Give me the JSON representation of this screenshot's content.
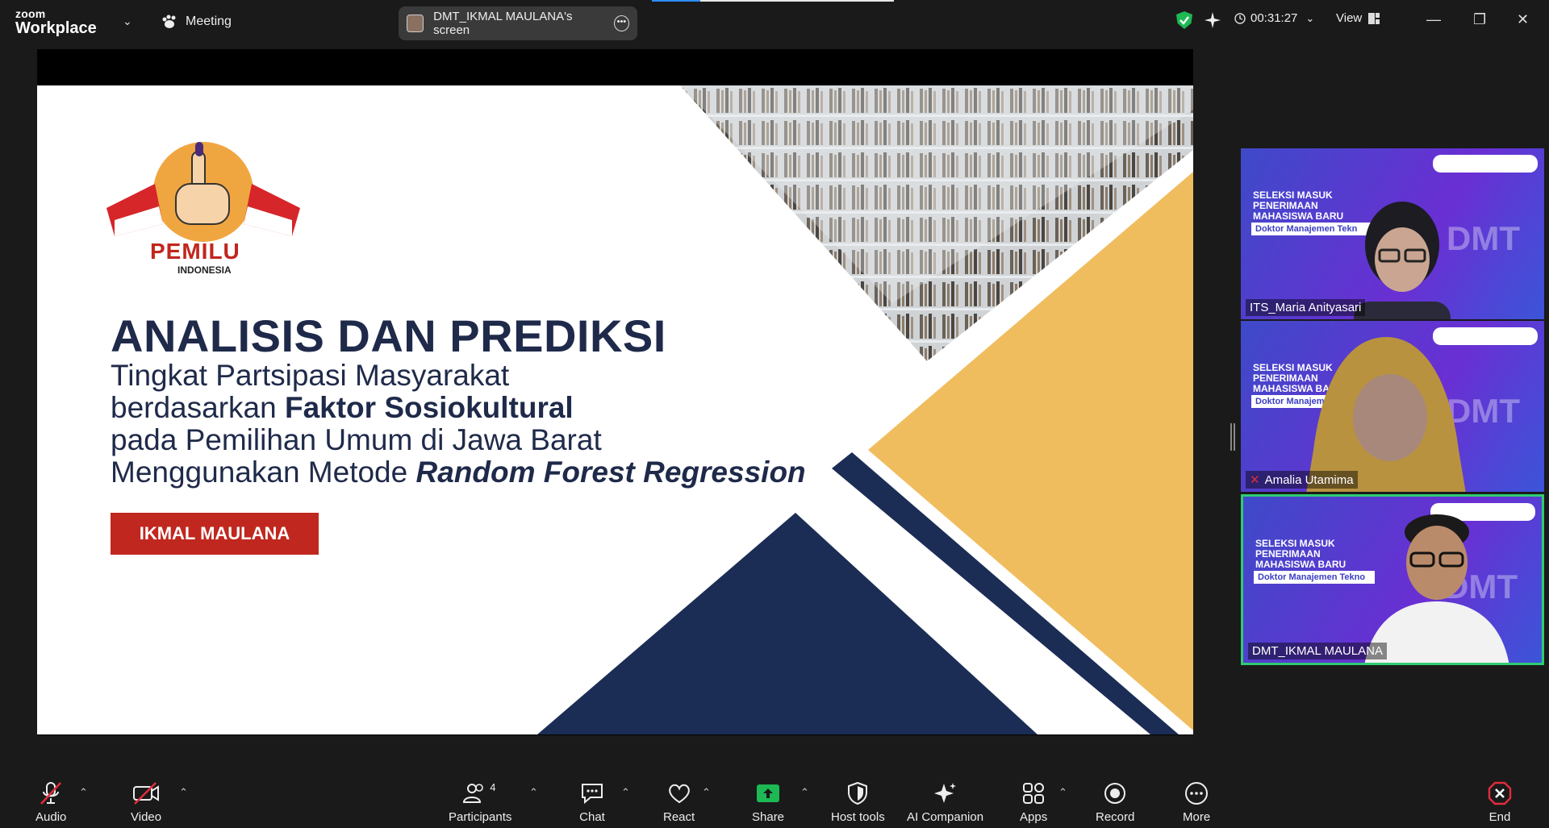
{
  "topbar": {
    "logo_small": "zoom",
    "logo_big": "Workplace",
    "meeting_label": "Meeting",
    "share_label": "DMT_IKMAL MAULANA's screen",
    "timer": "00:31:27",
    "view_label": "View"
  },
  "slide": {
    "logo_title": "PEMILU",
    "logo_sub": "INDONESIA",
    "title": "ANALISIS DAN PREDIKSI",
    "line1": "Tingkat Partsipasi Masyarakat",
    "line2_prefix": "berdasarkan ",
    "line2_bold": "Faktor Sosiokultural",
    "line3": "pada Pemilihan Umum di Jawa Barat",
    "line4_prefix": "Menggunakan Metode ",
    "line4_bold": "Random Forest Regression",
    "presenter": "IKMAL MAULANA"
  },
  "gallery": [
    {
      "name": "ITS_Maria Anityasari",
      "t1": "SELEKSI MASUK PENERIMAAN MAHASISWA BARU",
      "bar": "Doktor Manajemen Tekn",
      "dmt": "DMT"
    },
    {
      "name": "Amalia Utamima",
      "t1": "SELEKSI MASUK PENERIMAAN MAHASISWA BARU",
      "bar": "Doktor Manajemen",
      "dmt": "DMT"
    },
    {
      "name": "DMT_IKMAL MAULANA",
      "t1": "SELEKSI MASUK PENERIMAAN MAHASISWA BARU",
      "bar": "Doktor Manajemen Tekno",
      "dmt": "DMT"
    }
  ],
  "toolbar": {
    "audio": "Audio",
    "video": "Video",
    "participants": "Participants",
    "participants_count": "4",
    "chat": "Chat",
    "react": "React",
    "share": "Share",
    "host_tools": "Host tools",
    "ai_companion": "AI Companion",
    "apps": "Apps",
    "record": "Record",
    "more": "More",
    "end": "End"
  },
  "colors": {
    "accent_green": "#1db954",
    "end_red": "#e02d3c",
    "slide_navy": "#1f2a4a",
    "slide_gold": "#f0bd5e",
    "presenter_red": "#c0271e"
  }
}
